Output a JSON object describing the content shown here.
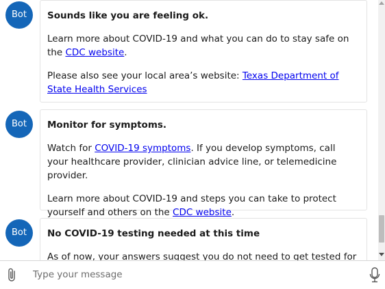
{
  "avatar_label": "Bot",
  "messages": [
    {
      "title": "Sounds like you are feeling ok.",
      "p1_text": "Learn more about COVID-19 and what you can do to stay safe on the ",
      "p1_link": "CDC website",
      "p1_end": ".",
      "p2_text": "Please also see your local area’s website: ",
      "p2_link": "Texas Department of State Health Services"
    },
    {
      "title": "Monitor for symptoms.",
      "p1_text": "Watch for ",
      "p1_link": "COVID-19 symptoms",
      "p1_end": ". If you develop symptoms, call your healthcare provider, clinician advice line, or telemedicine provider.",
      "p2_text": "Learn more about COVID-19 and steps you can take to protect yourself and others on the ",
      "p2_link": "CDC website",
      "p2_end": "."
    },
    {
      "title": "No COVID-19 testing needed at this time",
      "p1_text": "As of now, your answers suggest you do not need to get tested for"
    }
  ],
  "input": {
    "placeholder": "Type your message"
  },
  "colors": {
    "avatar_bg": "#1466b8",
    "link": "#0000ee"
  },
  "icons": {
    "attach": "paperclip-icon",
    "mic": "microphone-icon"
  }
}
